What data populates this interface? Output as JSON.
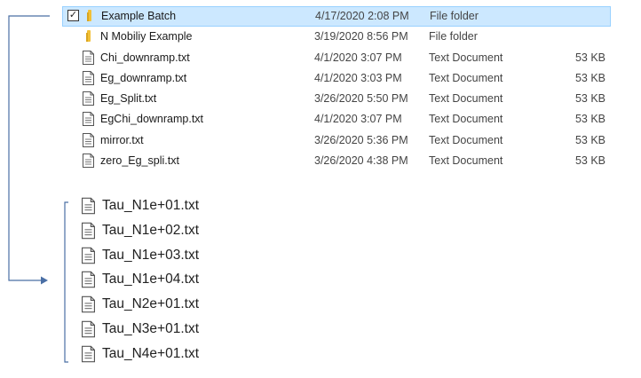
{
  "files": [
    {
      "name": "Example Batch",
      "date": "4/17/2020 2:08 PM",
      "type": "File folder",
      "size": "",
      "icon": "folder-icon",
      "selected": true,
      "checkbox": "✓"
    },
    {
      "name": "N Mobiliy Example",
      "date": "3/19/2020 8:56 PM",
      "type": "File folder",
      "size": "",
      "icon": "folder-icon"
    },
    {
      "name": "Chi_downramp.txt",
      "date": "4/1/2020 3:07 PM",
      "type": "Text Document",
      "size": "53 KB",
      "icon": "text-file-icon"
    },
    {
      "name": "Eg_downramp.txt",
      "date": "4/1/2020 3:03 PM",
      "type": "Text Document",
      "size": "53 KB",
      "icon": "text-file-icon"
    },
    {
      "name": "Eg_Split.txt",
      "date": "3/26/2020 5:50 PM",
      "type": "Text Document",
      "size": "53 KB",
      "icon": "text-file-icon"
    },
    {
      "name": "EgChi_downramp.txt",
      "date": "4/1/2020 3:07 PM",
      "type": "Text Document",
      "size": "53 KB",
      "icon": "text-file-icon"
    },
    {
      "name": "mirror.txt",
      "date": "3/26/2020 5:36 PM",
      "type": "Text Document",
      "size": "53 KB",
      "icon": "text-file-icon"
    },
    {
      "name": "zero_Eg_spli.txt",
      "date": "3/26/2020 4:38 PM",
      "type": "Text Document",
      "size": "53 KB",
      "icon": "text-file-icon"
    }
  ],
  "batch_contents": [
    {
      "name": "Tau_N1e+01.txt",
      "icon": "text-file-icon"
    },
    {
      "name": "Tau_N1e+02.txt",
      "icon": "text-file-icon"
    },
    {
      "name": "Tau_N1e+03.txt",
      "icon": "text-file-icon"
    },
    {
      "name": "Tau_N1e+04.txt",
      "icon": "text-file-icon"
    },
    {
      "name": "Tau_N2e+01.txt",
      "icon": "text-file-icon"
    },
    {
      "name": "Tau_N3e+01.txt",
      "icon": "text-file-icon"
    },
    {
      "name": "Tau_N4e+01.txt",
      "icon": "text-file-icon"
    }
  ],
  "colors": {
    "selection_bg": "#cce8ff",
    "selection_border": "#99d1ff",
    "connector": "#4a6fa5",
    "folder": "#f2c037"
  }
}
